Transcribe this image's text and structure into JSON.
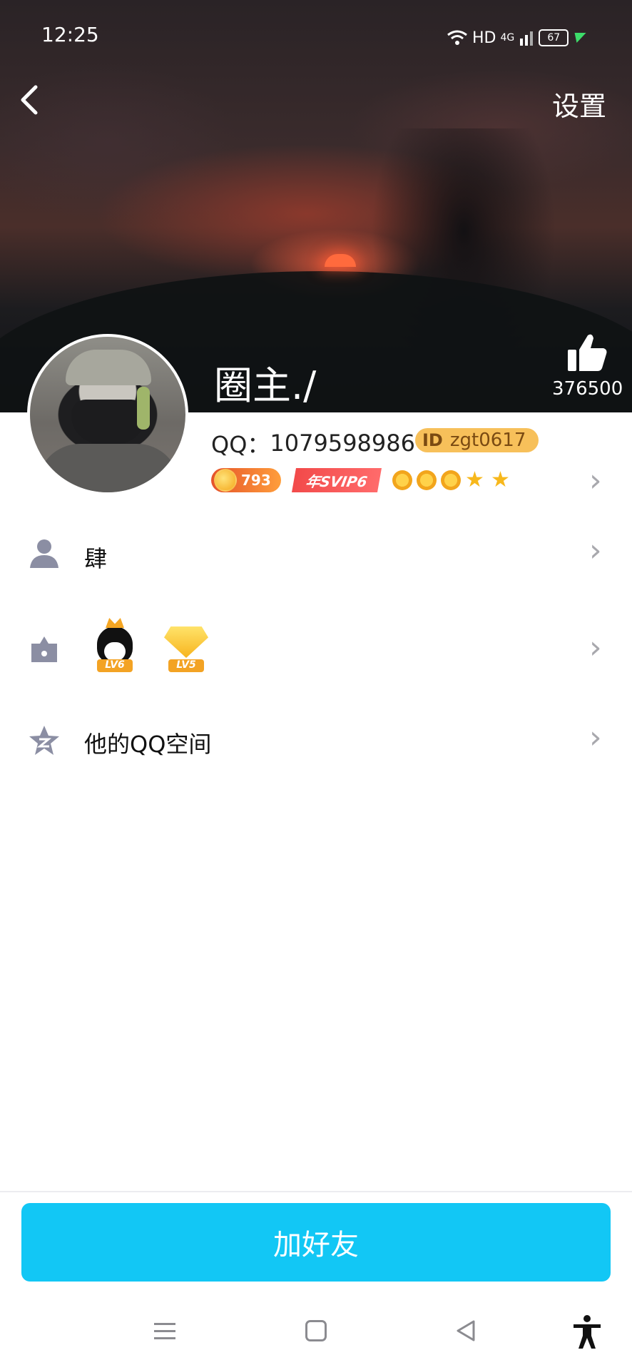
{
  "status_bar": {
    "time": "12:25",
    "network_label": "HD",
    "signal_label": "4G",
    "battery": "67"
  },
  "header": {
    "back_icon": "chevron-left-icon",
    "settings_label": "设置",
    "username": "圈主./",
    "like_icon": "thumbs-up-icon",
    "like_count": "376500"
  },
  "profile": {
    "qq_label": "QQ：",
    "qq_number": "1079598986",
    "id_tag": "ID",
    "id_value": "zgt0617",
    "coin_badge_text": "793",
    "svip_badge_text": "年SVIP6",
    "level_icons": [
      "sun-icon",
      "sun-icon",
      "sun-icon",
      "star-icon",
      "star-icon"
    ]
  },
  "list": [
    {
      "icon": "person-icon",
      "label": "肆"
    },
    {
      "icon": "crown-box-icon",
      "badges": [
        {
          "type": "qq-penguin",
          "text": "LV6"
        },
        {
          "type": "diamond",
          "text": "LV5"
        }
      ]
    },
    {
      "icon": "qzone-star-icon",
      "label": "他的QQ空间"
    }
  ],
  "footer": {
    "add_friend_label": "加好友"
  },
  "colors": {
    "accent": "#12c7f5",
    "chevron": "#a8a8ad",
    "icon_gray": "#8b8ea3"
  }
}
